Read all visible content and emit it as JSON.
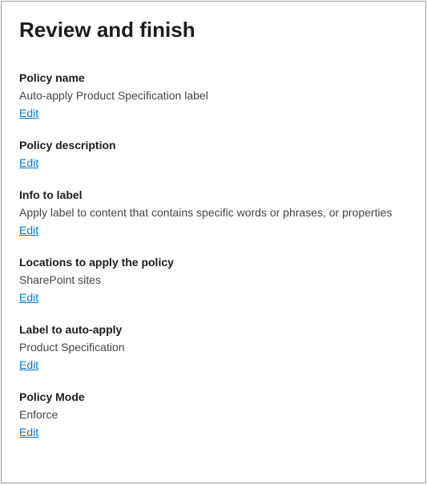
{
  "title": "Review and finish",
  "edit_label": "Edit",
  "sections": {
    "policy_name": {
      "label": "Policy name",
      "value": "Auto-apply Product Specification label"
    },
    "policy_description": {
      "label": "Policy description",
      "value": ""
    },
    "info_to_label": {
      "label": "Info to label",
      "value": "Apply label to content that contains specific words or phrases, or properties"
    },
    "locations": {
      "label": "Locations to apply the policy",
      "value": "SharePoint sites"
    },
    "label_to_apply": {
      "label": "Label to auto-apply",
      "value": "Product Specification"
    },
    "policy_mode": {
      "label": "Policy Mode",
      "value": "Enforce"
    }
  }
}
